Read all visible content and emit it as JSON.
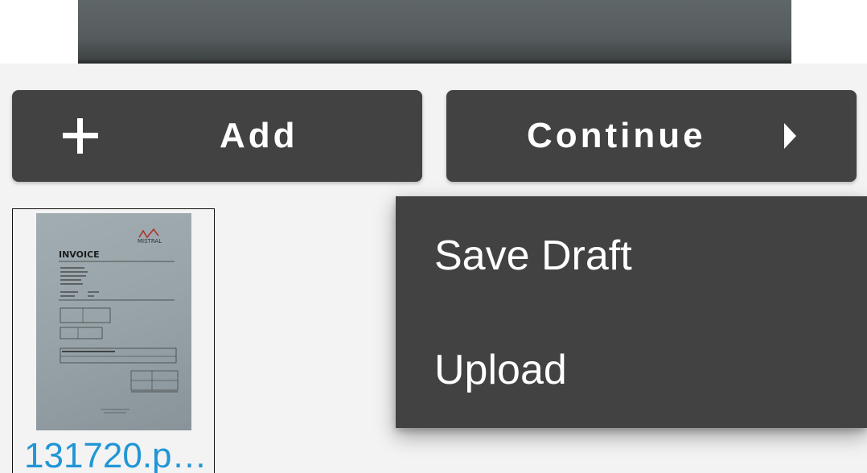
{
  "toolbar": {
    "add_label": "Add",
    "continue_label": "Continue",
    "add_icon": "plus-icon",
    "continue_icon": "chevron-right-icon"
  },
  "files": [
    {
      "name": "131720.p…",
      "thumbnail": {
        "heading": "INVOICE",
        "logo_text": "MISTRAL"
      }
    }
  ],
  "menu": {
    "items": [
      {
        "label": "Save Draft"
      },
      {
        "label": "Upload"
      }
    ]
  },
  "colors": {
    "button_bg": "#424242",
    "menu_bg": "#424242",
    "page_bg": "#f3f3f3",
    "file_name": "#2196d6"
  }
}
